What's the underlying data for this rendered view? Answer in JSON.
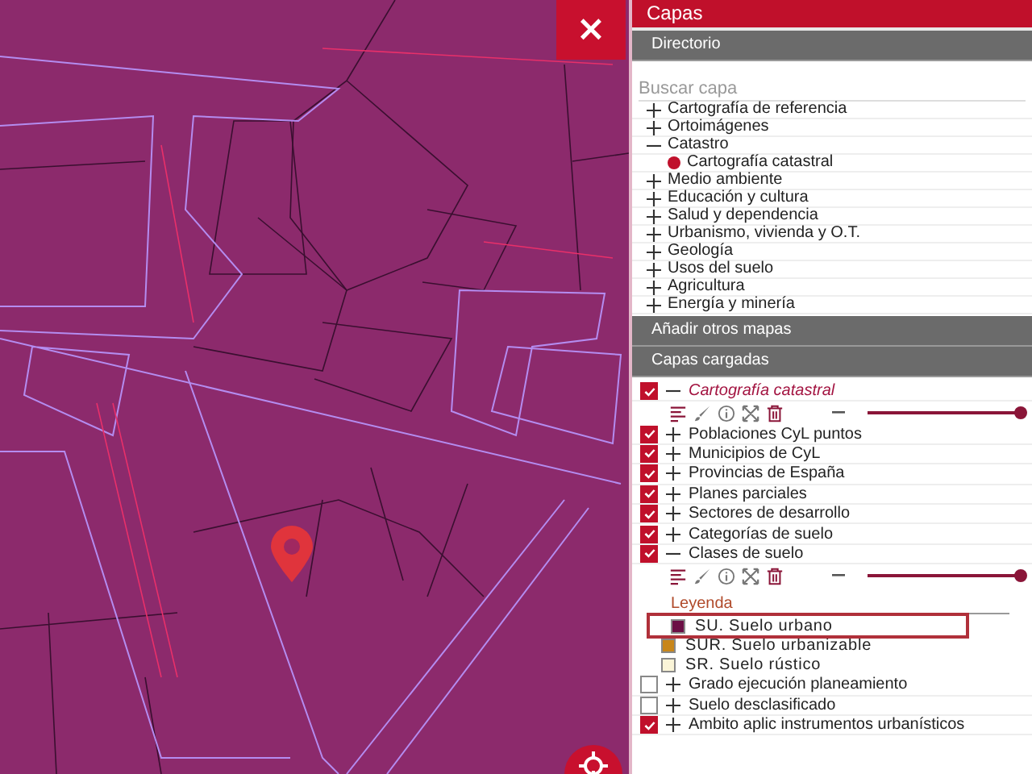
{
  "map": {
    "close_button": {
      "label": "×"
    }
  },
  "panel": {
    "title": "Capas",
    "directory": {
      "title": "Directorio",
      "search": {
        "placeholder": "Buscar capa"
      },
      "tree": [
        {
          "label": "Cartografía de referencia",
          "kind": "group",
          "expanded": false
        },
        {
          "label": "Ortoimágenes",
          "kind": "group",
          "expanded": false
        },
        {
          "label": "Catastro",
          "kind": "group",
          "expanded": true,
          "children": [
            {
              "label": "Cartografía catastral",
              "kind": "layer"
            }
          ]
        },
        {
          "label": "Medio ambiente",
          "kind": "group",
          "expanded": false
        },
        {
          "label": "Educación y cultura",
          "kind": "group",
          "expanded": false
        },
        {
          "label": "Salud y dependencia",
          "kind": "group",
          "expanded": false
        },
        {
          "label": "Urbanismo, vivienda y O.T.",
          "kind": "group",
          "expanded": false
        },
        {
          "label": "Geología",
          "kind": "group",
          "expanded": false
        },
        {
          "label": "Usos del suelo",
          "kind": "group",
          "expanded": false
        },
        {
          "label": "Agricultura",
          "kind": "group",
          "expanded": false
        },
        {
          "label": "Energía y minería",
          "kind": "group",
          "expanded": false
        }
      ]
    },
    "add_maps": {
      "title": "Añadir otros mapas"
    },
    "loaded": {
      "title": "Capas cargadas",
      "layers": [
        {
          "label": "Cartografía catastral",
          "checked": true,
          "expanded": true,
          "selected": true,
          "level": 0.97
        },
        {
          "label": "Poblaciones CyL puntos",
          "checked": true,
          "expanded": false,
          "selected": false
        },
        {
          "label": "Municipios de CyL",
          "checked": true,
          "expanded": false,
          "selected": false
        },
        {
          "label": "Provincias de España",
          "checked": true,
          "expanded": false,
          "selected": false
        },
        {
          "label": "Planes parciales",
          "checked": true,
          "expanded": false,
          "selected": false
        },
        {
          "label": "Sectores de desarrollo",
          "checked": true,
          "expanded": false,
          "selected": false
        },
        {
          "label": "Categorías de suelo",
          "checked": true,
          "expanded": false,
          "selected": false
        },
        {
          "label": "Clases de suelo",
          "checked": true,
          "expanded": true,
          "selected": false,
          "level": 0.97,
          "legend": {
            "title": "Leyenda",
            "items": [
              {
                "label": "SU. Suelo urbano",
                "color": "#6b0f45",
                "selected": true
              },
              {
                "label": "SUR. Suelo urbanizable",
                "color": "#c8861a",
                "selected": false
              },
              {
                "label": "SR. Suelo rústico",
                "color": "#fbf5d8",
                "selected": false
              }
            ]
          }
        },
        {
          "label": "Grado ejecución planeamiento",
          "checked": false,
          "expanded": false,
          "selected": false
        },
        {
          "label": "Suelo desclasificado",
          "checked": false,
          "expanded": false,
          "selected": false
        },
        {
          "label": "Ambito aplic instrumentos urbanísticos",
          "checked": true,
          "expanded": false,
          "selected": false
        }
      ]
    }
  }
}
